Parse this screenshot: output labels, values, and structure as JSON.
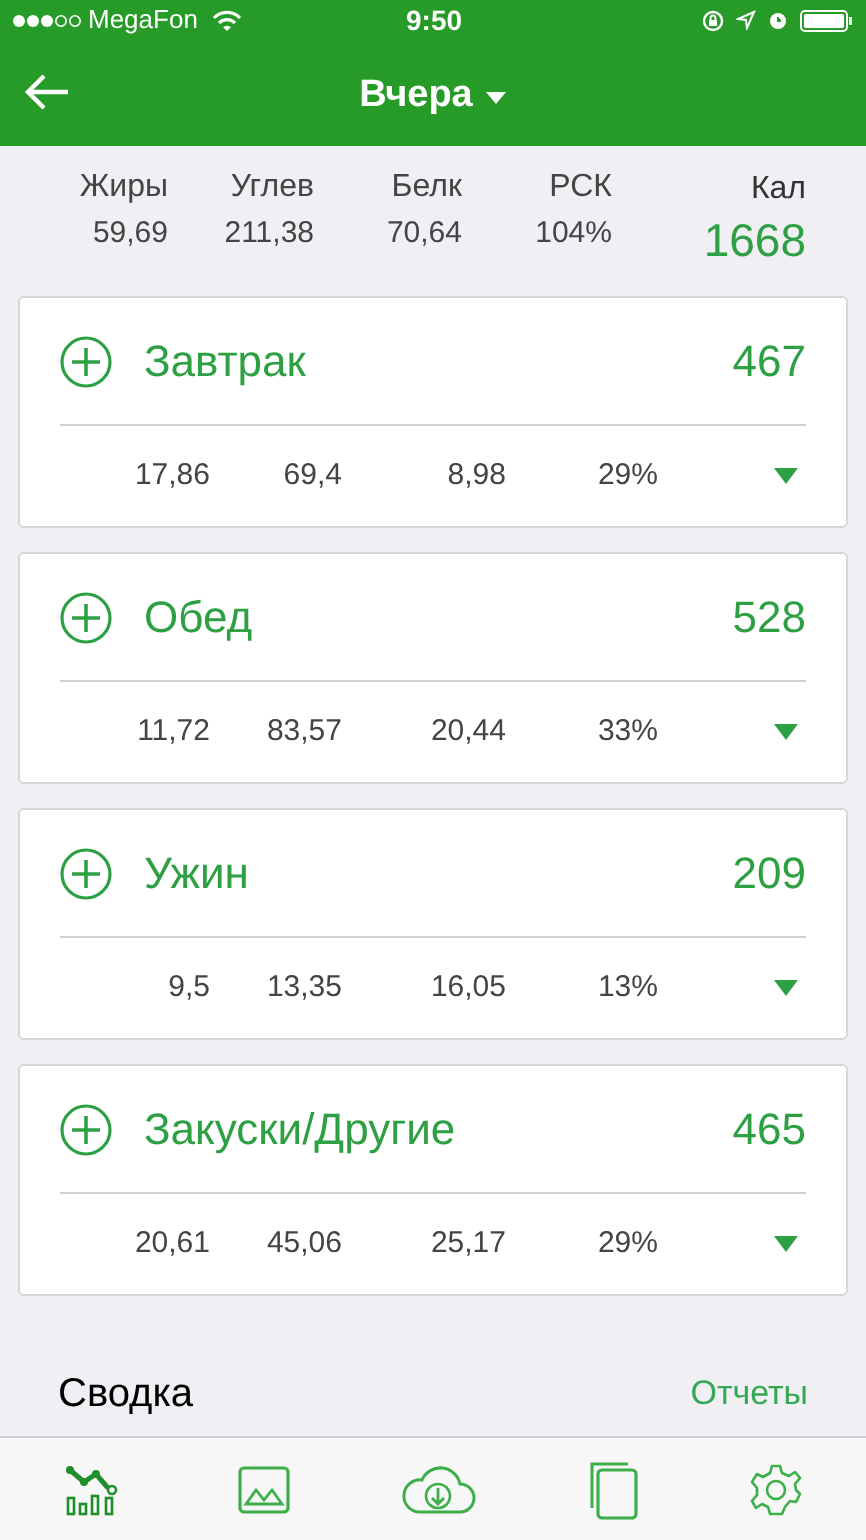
{
  "status_bar": {
    "carrier": "MegaFon",
    "time": "9:50"
  },
  "header": {
    "title": "Вчера"
  },
  "totals": {
    "columns": [
      {
        "label": "Жиры",
        "value": "59,69"
      },
      {
        "label": "Углев",
        "value": "211,38"
      },
      {
        "label": "Белк",
        "value": "70,64"
      },
      {
        "label": "РСК",
        "value": "104%"
      }
    ],
    "calories_label": "Кал",
    "calories": "1668"
  },
  "meals": [
    {
      "name": "Завтрак",
      "calories": "467",
      "values": [
        "17,86",
        "69,4",
        "8,98",
        "29%"
      ],
      "expanded": false
    },
    {
      "name": "Обед",
      "calories": "528",
      "values": [
        "11,72",
        "83,57",
        "20,44",
        "33%"
      ],
      "expanded": false
    },
    {
      "name": "Ужин",
      "calories": "209",
      "values": [
        "9,5",
        "13,35",
        "16,05",
        "13%"
      ],
      "expanded": false
    },
    {
      "name": "Закуски/Другие",
      "calories": "465",
      "values": [
        "20,61",
        "45,06",
        "25,17",
        "29%"
      ],
      "expanded": false
    }
  ],
  "summary": {
    "title": "Сводка",
    "link": "Отчеты"
  },
  "tab_bar": [
    {
      "kind": "chart",
      "selected": true
    },
    {
      "kind": "image",
      "selected": false
    },
    {
      "kind": "download",
      "selected": false
    },
    {
      "kind": "copy",
      "selected": false
    },
    {
      "kind": "settings",
      "selected": false
    }
  ]
}
